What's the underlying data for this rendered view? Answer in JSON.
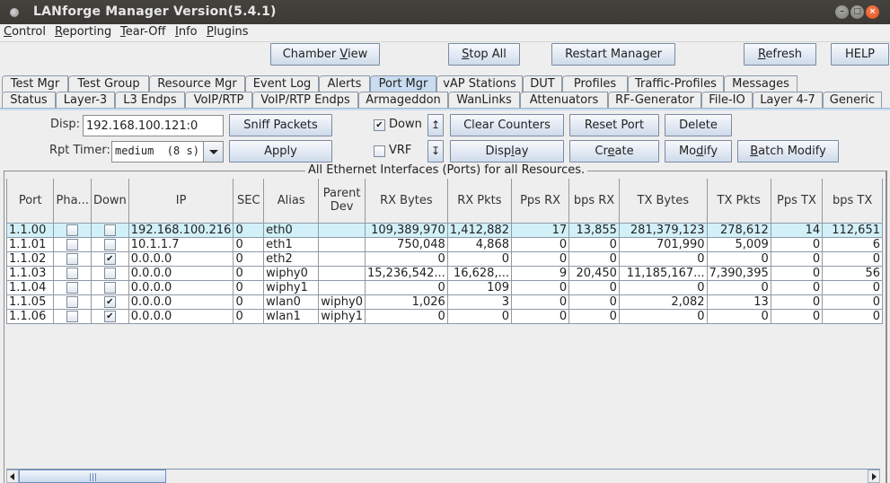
{
  "window": {
    "title": "LANforge Manager   Version(5.4.1)",
    "controls": [
      "minimize",
      "maximize",
      "close"
    ]
  },
  "menu": [
    {
      "label": "Control",
      "mnemonic": "C"
    },
    {
      "label": "Reporting",
      "mnemonic": "R"
    },
    {
      "label": "Tear-Off",
      "mnemonic": "T"
    },
    {
      "label": "Info",
      "mnemonic": "I"
    },
    {
      "label": "Plugins",
      "mnemonic": "P"
    }
  ],
  "toolbar": {
    "chamber_view": "Chamber View",
    "stop_all": "Stop All",
    "restart_manager": "Restart Manager",
    "refresh": "Refresh",
    "help": "HELP"
  },
  "tabs": {
    "row1": [
      "Test Mgr",
      "Test Group",
      "Resource Mgr",
      "Event Log",
      "Alerts",
      "Port Mgr",
      "vAP Stations",
      "DUT",
      "Profiles",
      "Traffic-Profiles",
      "Messages"
    ],
    "row2": [
      "Status",
      "Layer-3",
      "L3 Endps",
      "VoIP/RTP",
      "VoIP/RTP Endps",
      "Armageddon",
      "WanLinks",
      "Attenuators",
      "RF-Generator",
      "File-IO",
      "Layer 4-7",
      "Generic"
    ],
    "selected": "Port Mgr"
  },
  "controls": {
    "disp_label": "Disp:",
    "disp_value": "192.168.100.121:0",
    "rpt_timer_label": "Rpt Timer:",
    "rpt_timer_value": "medium  (8 s)",
    "sniff_packets": "Sniff Packets",
    "apply": "Apply",
    "down_label": "Down",
    "down_checked": true,
    "vrf_label": "VRF",
    "vrf_checked": false,
    "sort_up_icon": "↥",
    "sort_down_icon": "↧",
    "clear_counters": "Clear Counters",
    "reset_port": "Reset Port",
    "delete": "Delete",
    "display": "Display",
    "create": "Create",
    "modify": "Modify",
    "batch_modify": "Batch Modify"
  },
  "group_title": "All Ethernet Interfaces (Ports) for all Resources.",
  "table": {
    "columns": [
      "Port",
      "Pha...",
      "Down",
      "IP",
      "SEC",
      "Alias",
      "Parent Dev",
      "RX Bytes",
      "RX Pkts",
      "Pps RX",
      "bps RX",
      "TX Bytes",
      "TX Pkts",
      "Pps TX",
      "bps TX"
    ],
    "rows": [
      {
        "port": "1.1.00",
        "phantom": false,
        "down": false,
        "ip": "192.168.100.216",
        "sec": "0",
        "alias": "eth0",
        "parent": "",
        "rx_bytes": "109,389,970",
        "rx_pkts": "1,412,882",
        "pps_rx": "17",
        "bps_rx": "13,855",
        "tx_bytes": "281,379,123",
        "tx_pkts": "278,612",
        "pps_tx": "14",
        "bps_tx": "112,651",
        "selected": true
      },
      {
        "port": "1.1.01",
        "phantom": false,
        "down": false,
        "ip": "10.1.1.7",
        "sec": "0",
        "alias": "eth1",
        "parent": "",
        "rx_bytes": "750,048",
        "rx_pkts": "4,868",
        "pps_rx": "0",
        "bps_rx": "0",
        "tx_bytes": "701,990",
        "tx_pkts": "5,009",
        "pps_tx": "0",
        "bps_tx": "6",
        "selected": false
      },
      {
        "port": "1.1.02",
        "phantom": false,
        "down": true,
        "ip": "0.0.0.0",
        "sec": "0",
        "alias": "eth2",
        "parent": "",
        "rx_bytes": "0",
        "rx_pkts": "0",
        "pps_rx": "0",
        "bps_rx": "0",
        "tx_bytes": "0",
        "tx_pkts": "0",
        "pps_tx": "0",
        "bps_tx": "0",
        "selected": false
      },
      {
        "port": "1.1.03",
        "phantom": false,
        "down": false,
        "ip": "0.0.0.0",
        "sec": "0",
        "alias": "wiphy0",
        "parent": "",
        "rx_bytes": "15,236,542...",
        "rx_pkts": "16,628,...",
        "pps_rx": "9",
        "bps_rx": "20,450",
        "tx_bytes": "11,185,167...",
        "tx_pkts": "7,390,395",
        "pps_tx": "0",
        "bps_tx": "56",
        "selected": false
      },
      {
        "port": "1.1.04",
        "phantom": false,
        "down": false,
        "ip": "0.0.0.0",
        "sec": "0",
        "alias": "wiphy1",
        "parent": "",
        "rx_bytes": "0",
        "rx_pkts": "109",
        "pps_rx": "0",
        "bps_rx": "0",
        "tx_bytes": "0",
        "tx_pkts": "0",
        "pps_tx": "0",
        "bps_tx": "0",
        "selected": false
      },
      {
        "port": "1.1.05",
        "phantom": false,
        "down": true,
        "ip": "0.0.0.0",
        "sec": "0",
        "alias": "wlan0",
        "parent": "wiphy0",
        "rx_bytes": "1,026",
        "rx_pkts": "3",
        "pps_rx": "0",
        "bps_rx": "0",
        "tx_bytes": "2,082",
        "tx_pkts": "13",
        "pps_tx": "0",
        "bps_tx": "0",
        "selected": false
      },
      {
        "port": "1.1.06",
        "phantom": false,
        "down": true,
        "ip": "0.0.0.0",
        "sec": "0",
        "alias": "wlan1",
        "parent": "wiphy1",
        "rx_bytes": "0",
        "rx_pkts": "0",
        "pps_rx": "0",
        "bps_rx": "0",
        "tx_bytes": "0",
        "tx_pkts": "0",
        "pps_tx": "0",
        "bps_tx": "0",
        "selected": false
      }
    ]
  },
  "colors": {
    "selected_tab": "#c9dcf0",
    "selected_row": "#d2f0f8",
    "titlebar": "#3f3d39",
    "close_button": "#e95420"
  }
}
